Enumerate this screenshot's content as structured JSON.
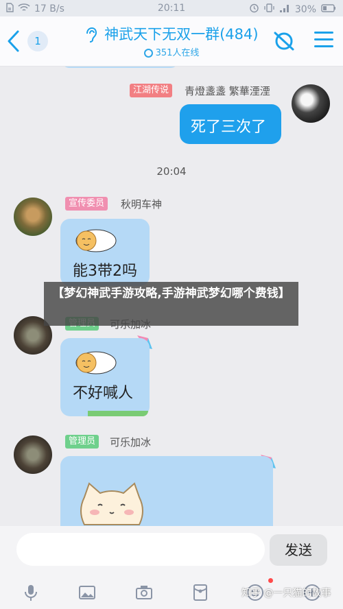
{
  "status_bar": {
    "left": "17 B/s",
    "time": "20:11",
    "battery": "30%"
  },
  "header": {
    "unread_count": "1",
    "title": "神武天下无双一群(484)",
    "online": "351人在线"
  },
  "messages": [
    {
      "tag": "江湖传说",
      "nick": "青燈盞盞 繁華湮湮",
      "text": "死了三次了"
    },
    {
      "timestamp": "20:04"
    },
    {
      "tag": "宣传委员",
      "nick": "秋明车神",
      "text": "能3带2吗"
    },
    {
      "tag": "管理员",
      "nick": "可乐加冰",
      "text": "不好喊人"
    },
    {
      "tag": "管理员",
      "nick": "可乐加冰"
    }
  ],
  "banner_text": "【梦幻神武手游攻略,手游神武梦幻哪个费钱】",
  "input": {
    "placeholder": "",
    "send_label": "发送"
  },
  "watermark": "知乎 @一只猫的故事",
  "colors": {
    "accent": "#1aa1ea",
    "tag_red": "#f27f83",
    "tag_pink": "#f08fb0",
    "tag_green": "#6fd08c",
    "bubble_in": "#b5d9f6",
    "bubble_out": "#1fa0ec"
  }
}
